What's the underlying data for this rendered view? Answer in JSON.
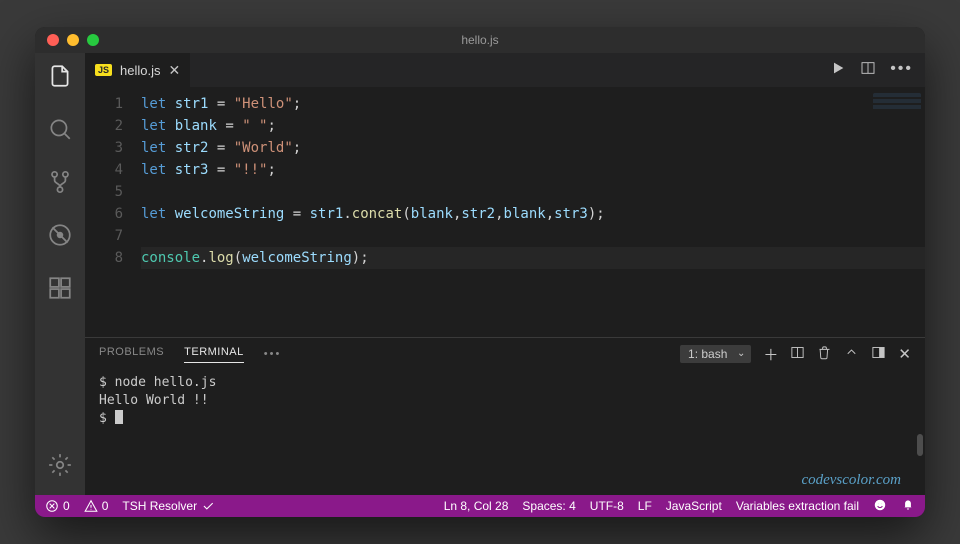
{
  "window": {
    "title": "hello.js"
  },
  "tab": {
    "badge": "JS",
    "filename": "hello.js"
  },
  "code": {
    "lines": [
      {
        "n": "1",
        "tokens": [
          [
            "kw",
            "let"
          ],
          [
            "op",
            " "
          ],
          [
            "var",
            "str1"
          ],
          [
            "op",
            " = "
          ],
          [
            "str",
            "\"Hello\""
          ],
          [
            "op",
            ";"
          ]
        ]
      },
      {
        "n": "2",
        "tokens": [
          [
            "kw",
            "let"
          ],
          [
            "op",
            " "
          ],
          [
            "var",
            "blank"
          ],
          [
            "op",
            " = "
          ],
          [
            "str",
            "\" \""
          ],
          [
            "op",
            ";"
          ]
        ]
      },
      {
        "n": "3",
        "tokens": [
          [
            "kw",
            "let"
          ],
          [
            "op",
            " "
          ],
          [
            "var",
            "str2"
          ],
          [
            "op",
            " = "
          ],
          [
            "str",
            "\"World\""
          ],
          [
            "op",
            ";"
          ]
        ]
      },
      {
        "n": "4",
        "tokens": [
          [
            "kw",
            "let"
          ],
          [
            "op",
            " "
          ],
          [
            "var",
            "str3"
          ],
          [
            "op",
            " = "
          ],
          [
            "str",
            "\"!!\""
          ],
          [
            "op",
            ";"
          ]
        ]
      },
      {
        "n": "5",
        "tokens": []
      },
      {
        "n": "6",
        "tokens": [
          [
            "kw",
            "let"
          ],
          [
            "op",
            " "
          ],
          [
            "var",
            "welcomeString"
          ],
          [
            "op",
            " = "
          ],
          [
            "var",
            "str1"
          ],
          [
            "op",
            "."
          ],
          [
            "fn",
            "concat"
          ],
          [
            "op",
            "("
          ],
          [
            "var",
            "blank"
          ],
          [
            "op",
            ","
          ],
          [
            "var",
            "str2"
          ],
          [
            "op",
            ","
          ],
          [
            "var",
            "blank"
          ],
          [
            "op",
            ","
          ],
          [
            "var",
            "str3"
          ],
          [
            "op",
            ");"
          ]
        ]
      },
      {
        "n": "7",
        "tokens": []
      },
      {
        "n": "8",
        "hl": true,
        "tokens": [
          [
            "obj",
            "console"
          ],
          [
            "op",
            "."
          ],
          [
            "fn",
            "log"
          ],
          [
            "op",
            "("
          ],
          [
            "var",
            "welcomeString"
          ],
          [
            "op",
            ");"
          ]
        ]
      }
    ]
  },
  "panel": {
    "tabs": {
      "problems": "PROBLEMS",
      "terminal": "TERMINAL"
    },
    "term_select": "1: bash",
    "terminal_lines": [
      "$ node hello.js",
      "Hello World !!",
      "$ "
    ],
    "watermark": "codevscolor.com"
  },
  "status": {
    "errors": "0",
    "warnings": "0",
    "ext": "TSH Resolver",
    "cursor": "Ln 8, Col 28",
    "spaces": "Spaces: 4",
    "encoding": "UTF-8",
    "eol": "LF",
    "lang": "JavaScript",
    "msg": "Variables extraction fail"
  }
}
